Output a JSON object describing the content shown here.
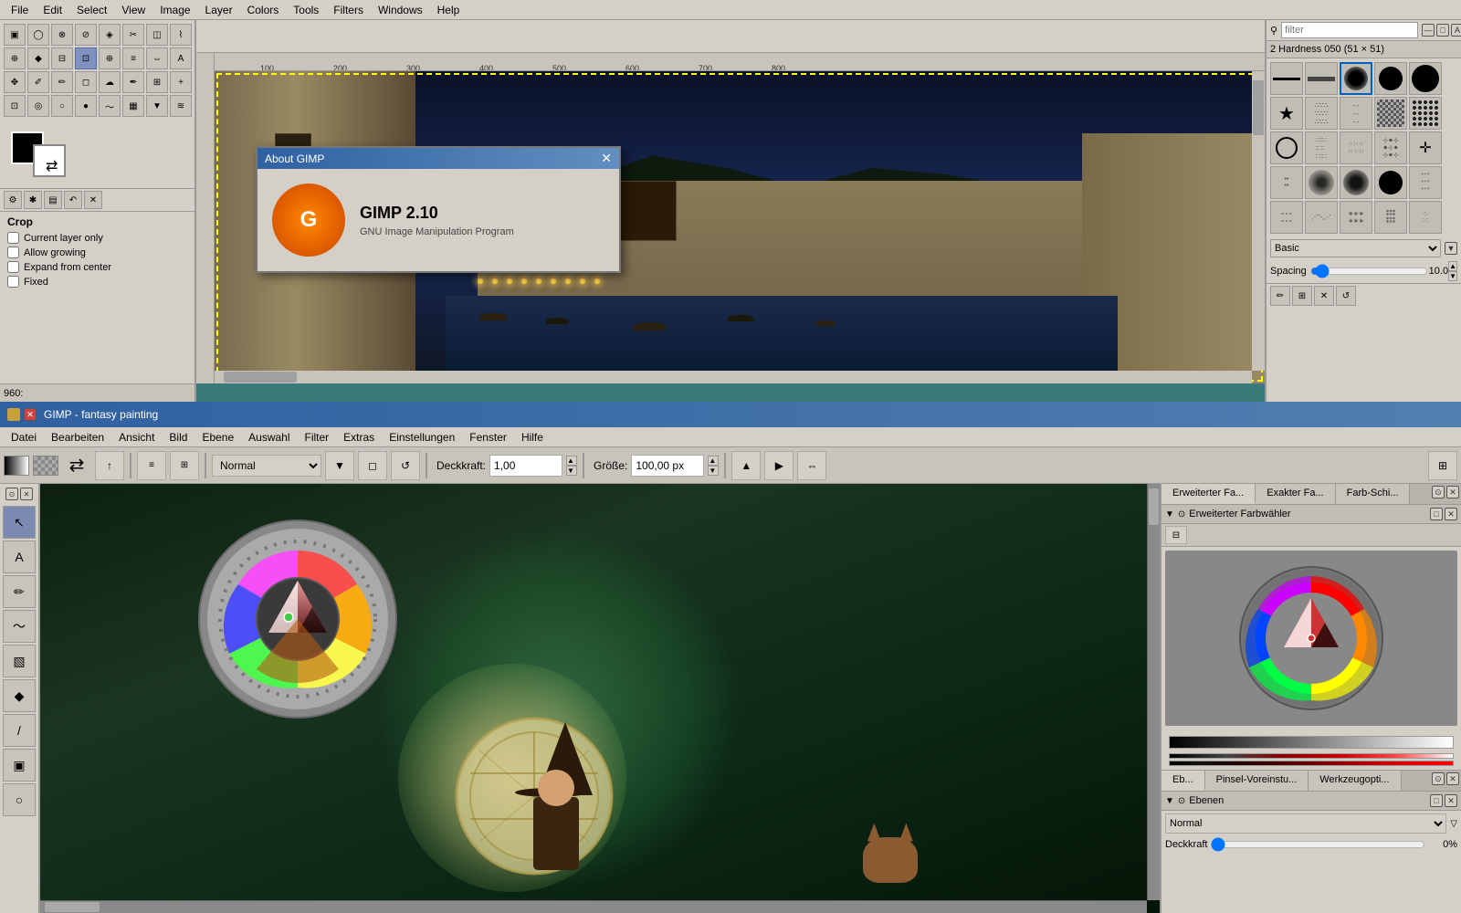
{
  "top_window": {
    "menu": {
      "items": [
        "File",
        "Edit",
        "Select",
        "View",
        "Image",
        "Layer",
        "Colors",
        "Tools",
        "Filters",
        "Windows",
        "Help"
      ]
    },
    "canvas": {
      "image_desc": "Dubrovnik night scene with ancient walls and harbor",
      "ruler_marks": [
        "100",
        "200",
        "300",
        "400",
        "500",
        "600",
        "700",
        "800"
      ],
      "status_text": "960:"
    },
    "tool_options": {
      "title": "Crop",
      "option1": "Current layer only",
      "option2": "Allow growing",
      "option3": "Expand from center",
      "option4": "Fixed"
    },
    "brush_panel": {
      "filter_placeholder": "filter",
      "brush_title": "2  Hardness 050 (51 × 51)",
      "category_label": "Basic",
      "spacing_label": "Spacing",
      "spacing_value": "10.0"
    },
    "about_dialog": {
      "title": "About GIMP",
      "close_btn": "✕"
    }
  },
  "bottom_window": {
    "title": "GIMP - fantasy painting",
    "menu": {
      "items": [
        "Datei",
        "Bearbeiten",
        "Ansicht",
        "Bild",
        "Ebene",
        "Auswahl",
        "Filter",
        "Extras",
        "Einstellungen",
        "Fenster",
        "Hilfe"
      ]
    },
    "toolbar": {
      "mode_label": "Normal",
      "opacity_label": "Deckkraft:",
      "opacity_value": "1,00",
      "size_label": "Größe:",
      "size_value": "100,00 px"
    },
    "farbwahler_tabs": {
      "tab1": "Erweiterter Fa...",
      "tab2": "Exakter Fa...",
      "tab3": "Farb-Schi..."
    },
    "farbwahler_title": "Erweiterter Farbwähler",
    "ebenen_tabs": {
      "tab1": "Eb...",
      "tab2": "Pinsel-Voreinstu...",
      "tab3": "Werkzeugopti..."
    },
    "ebenen_title": "Ebenen",
    "ebenen_mode": "Normal",
    "deckkraft_label": "Deckkraft",
    "deckkraft_value": "0%",
    "controls": {
      "close": "✕",
      "minimize": "—"
    }
  },
  "toolbox_icons": {
    "tools": [
      "↖",
      "⊡",
      "A",
      "✥",
      "⊕",
      "⊗",
      "▣",
      "◯",
      "✂",
      "⊘",
      "◆",
      "✏",
      "✐",
      "✒",
      "☁",
      "◎",
      "○",
      "▦",
      "⊞",
      "+",
      "⇔",
      "≡",
      "⊕",
      "◈"
    ]
  },
  "bottom_tools": [
    "↖",
    "A",
    "✏",
    "▭",
    "▧",
    "◆",
    "/",
    "▣",
    "○"
  ],
  "colors": {
    "teal_bg": "#3a7a7a",
    "panel_bg": "#d4d0c8",
    "menu_bg": "#d4d0c8",
    "accent_blue": "#3060a0",
    "canvas_dark": "#1a1a3a"
  }
}
